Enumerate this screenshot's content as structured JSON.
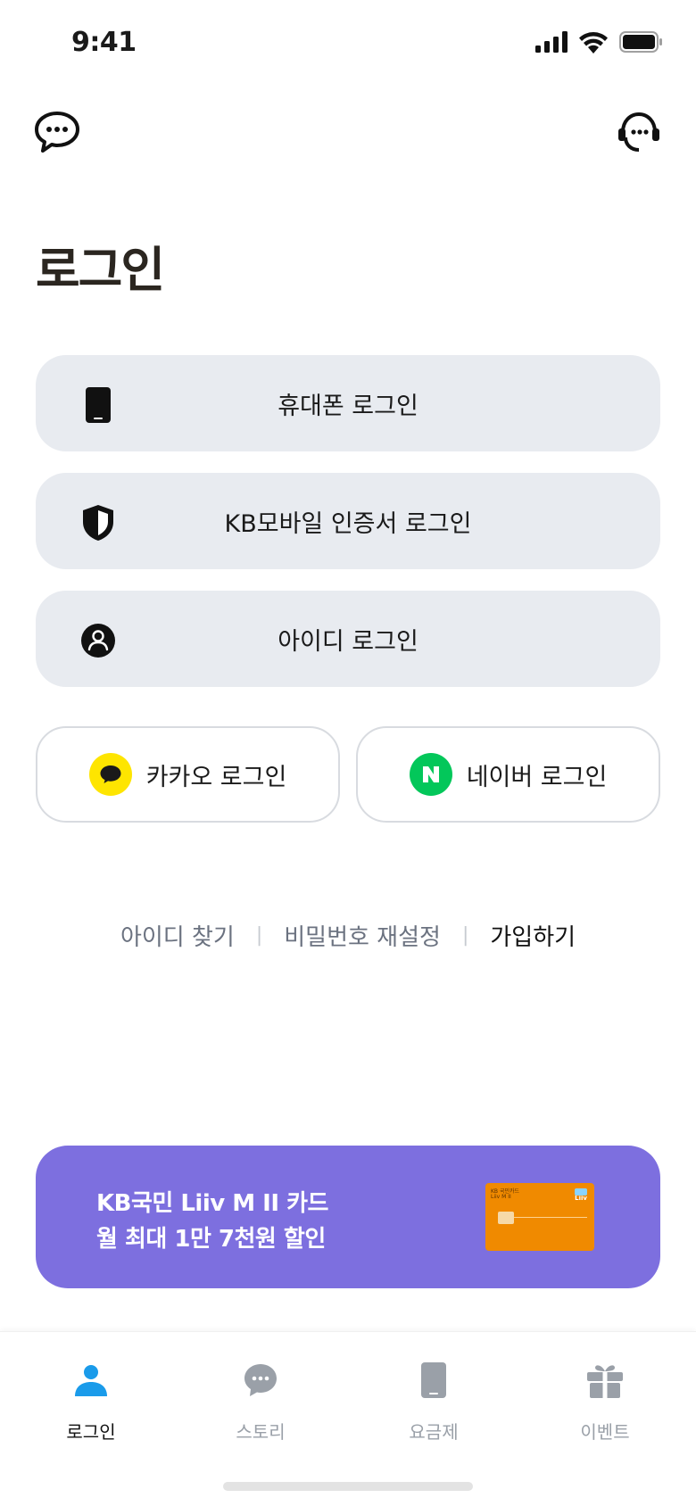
{
  "status_bar": {
    "time": "9:41"
  },
  "title": "로그인",
  "login_options": [
    {
      "label": "휴대폰 로그인",
      "icon": "phone-icon"
    },
    {
      "label": "KB모바일 인증서 로그인",
      "icon": "shield-icon"
    },
    {
      "label": "아이디 로그인",
      "icon": "person-icon"
    }
  ],
  "social_login": {
    "kakao": {
      "label": "카카오 로그인",
      "color": "#FEE500"
    },
    "naver": {
      "label": "네이버 로그인",
      "color": "#03C75A"
    }
  },
  "links": {
    "find_id": "아이디 찾기",
    "reset_password": "비밀번호 재설정",
    "signup": "가입하기"
  },
  "banner": {
    "line1": "KB국민 Liiv M II 카드",
    "line2": "월 최대 1만 7천원 할인",
    "color": "#7D6FDF",
    "card": {
      "brand_small": "KB 국민카드",
      "name_small": "Liiv M II",
      "logo": "Liiv"
    }
  },
  "tabs": [
    {
      "label": "로그인",
      "icon": "person-icon",
      "active": true
    },
    {
      "label": "스토리",
      "icon": "chat-bubble-icon",
      "active": false
    },
    {
      "label": "요금제",
      "icon": "phone-icon",
      "active": false
    },
    {
      "label": "이벤트",
      "icon": "gift-icon",
      "active": false
    }
  ],
  "accent_color": "#1A9BEA"
}
